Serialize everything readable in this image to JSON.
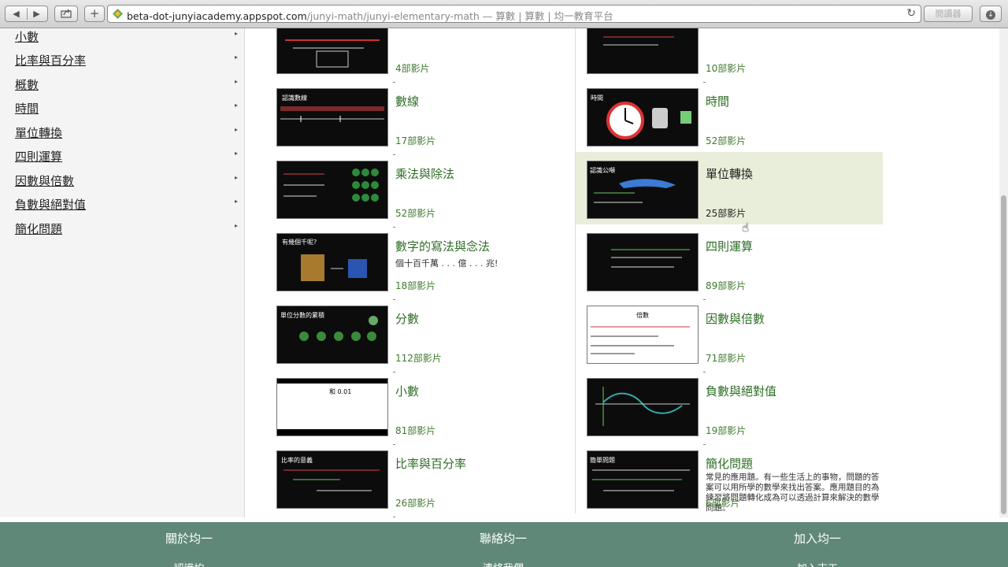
{
  "browser": {
    "url_domain": "beta-dot-junyiacademy.appspot.com",
    "url_path": "/junyi-math/junyi-elementary-math",
    "page_title": " — 算數 | 算數 | 均一教育平台",
    "reader_label": "閱讀器",
    "plus_label": "+"
  },
  "sidebar": {
    "items": [
      {
        "label": "小數"
      },
      {
        "label": "比率與百分率"
      },
      {
        "label": "概數"
      },
      {
        "label": "時間"
      },
      {
        "label": "單位轉換"
      },
      {
        "label": "四則運算"
      },
      {
        "label": "因數與倍數"
      },
      {
        "label": "負數與絕對值"
      },
      {
        "label": "簡化問題"
      }
    ],
    "arrow": "▸"
  },
  "left_cards": [
    {
      "title": "",
      "count": "4部影片"
    },
    {
      "title": "數線",
      "count": "17部影片"
    },
    {
      "title": "乘法與除法",
      "count": "52部影片"
    },
    {
      "title": "數字的寫法與念法",
      "subtitle": "個十百千萬 . . . 億 . . . 兆!",
      "count": "18部影片"
    },
    {
      "title": "分數",
      "count": "112部影片"
    },
    {
      "title": "小數",
      "count": "81部影片"
    },
    {
      "title": "比率與百分率",
      "count": "26部影片"
    }
  ],
  "right_cards": [
    {
      "title": "",
      "count": "10部影片"
    },
    {
      "title": "時間",
      "count": "52部影片"
    },
    {
      "title": "單位轉換",
      "count": "25部影片"
    },
    {
      "title": "四則運算",
      "count": "89部影片"
    },
    {
      "title": "因數與倍數",
      "count": "71部影片"
    },
    {
      "title": "負數與絕對值",
      "count": "19部影片"
    },
    {
      "title": "簡化問題",
      "description": "常見的應用題。有一些生活上的事物，問題的答案可以用所學的數學來找出答案。應用題目的為練習將問題轉化成為可以透過計算來解決的數學問題。",
      "count": "6部影片"
    }
  ],
  "thumb_text": {
    "number_line": "認識數線",
    "time": "時間",
    "unit": "認識公噸",
    "digits": "有幾個千呢?",
    "fraction": "單位分數的累積",
    "factor": "倍數",
    "hundredth": "和 0.01",
    "ratio": "比率的意義",
    "simplify": "簡單問題"
  },
  "footer": {
    "col1": "關於均一",
    "col2": "聯絡均一",
    "col3": "加入均一",
    "sub1": "認識均",
    "sub2": "連絡我們",
    "sub3": "加入志工"
  },
  "colors": {
    "footer_bg": "#5f8878",
    "title_green": "#2e6d25",
    "highlight_bg": "#e8eed9"
  }
}
